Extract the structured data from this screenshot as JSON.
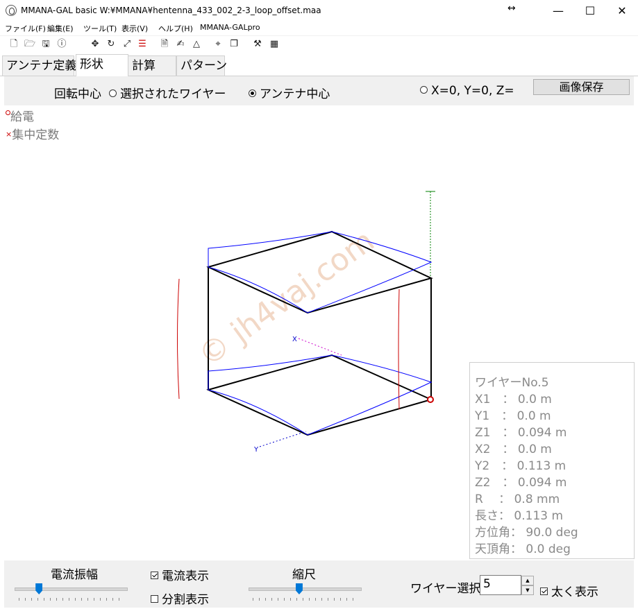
{
  "window": {
    "title": "MMANA-GAL basic  W:¥MMANA¥hentenna_433_002_2-3_loop_offset.maa",
    "controls": {
      "minimize": "—",
      "maximize": "☐",
      "close": "✕",
      "resize": "↔"
    }
  },
  "menu": [
    "ファイル(F)",
    "編集(E)",
    "ツール(T)",
    "表示(V)",
    "ヘルプ(H)",
    "MMANA-GALpro"
  ],
  "toolbar": [
    "new-file-icon",
    "open-folder-icon",
    "save-disk-icon",
    "info-icon",
    "move-arrows-icon",
    "rotate-icon",
    "zoom-icon",
    "wire-split-icon",
    "document-icon",
    "signature-icon",
    "triangle-icon",
    "crosshair-icon",
    "copy-icon",
    "tools-icon",
    "calculator-icon"
  ],
  "tabs": [
    "アンテナ定義",
    "形状",
    "計算",
    "パターン"
  ],
  "active_tab": 1,
  "rotation": {
    "label": "回転中心",
    "options": [
      "選択されたワイヤー",
      "アンテナ中心",
      "X=0, Y=0, Z="
    ],
    "selected": 1,
    "save_button": "画像保存"
  },
  "legend": {
    "feed": "給電",
    "load": "集中定数"
  },
  "view": {
    "axes": {
      "x": "X",
      "y": "Y",
      "z": "Z"
    },
    "watermark": "© jh4vaj.com",
    "colors": {
      "wire": "#000000",
      "current": "#0000ff",
      "axis_z": "#008000",
      "axis_xy": "#0000ff",
      "feed": "#cc0000",
      "load": "#cc0000"
    }
  },
  "wire_info": [
    "ワイヤーNo.5",
    "X1　：  0.0 m",
    "Y1　：  0.0 m",
    "Z1　：  0.094 m",
    "X2　：  0.0 m",
    "Y2　：  0.113 m",
    "Z2　：  0.094 m",
    "R　 ：  0.8 mm",
    "長さ：  0.113 m",
    "方位角：  90.0 deg",
    "天頂角：  0.0 deg"
  ],
  "bottom": {
    "current_amp_label": "電流振幅",
    "current_amp_value": 0.2,
    "show_current": {
      "label": "電流表示",
      "checked": true
    },
    "show_segments": {
      "label": "分割表示",
      "checked": false
    },
    "scale_label": "縮尺",
    "scale_value": 0.45,
    "wire_select_label": "ワイヤー選択",
    "wire_select_value": "5",
    "bold": {
      "label": "太く表示",
      "checked": true
    }
  }
}
